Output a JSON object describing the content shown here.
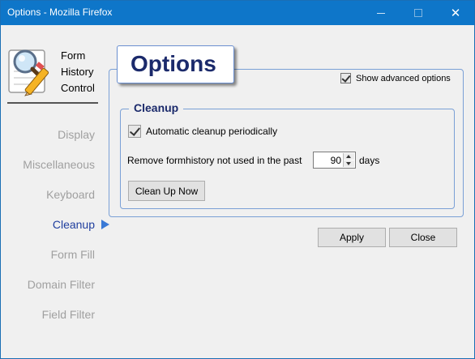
{
  "window": {
    "title": "Options - Mozilla Firefox",
    "controls": {
      "minimize": "minimize-icon",
      "maximize": "maximize-icon",
      "close": "close-icon"
    }
  },
  "brand": {
    "icon": "magnifier-pencil-icon",
    "lines": [
      "Form",
      "History",
      "Control"
    ]
  },
  "sidebar": {
    "items": [
      {
        "label": "Display"
      },
      {
        "label": "Miscellaneous"
      },
      {
        "label": "Keyboard"
      },
      {
        "label": "Cleanup"
      },
      {
        "label": "Form Fill"
      },
      {
        "label": "Domain Filter"
      },
      {
        "label": "Field Filter"
      }
    ],
    "active": "Cleanup",
    "active_color": "#1f3e9e",
    "inactive_color": "#a0a0a0"
  },
  "main": {
    "title": "Options",
    "show_advanced": {
      "label": "Show advanced options",
      "checked": true
    },
    "cleanup": {
      "legend": "Cleanup",
      "auto_cleanup": {
        "label": "Automatic cleanup periodically",
        "checked": true
      },
      "remove_label": "Remove formhistory not used in the past",
      "days_value": "90",
      "days_unit": "days",
      "cleanup_now": "Clean Up Now"
    }
  },
  "footer": {
    "apply": "Apply",
    "close": "Close"
  },
  "colors": {
    "titlebar": "#0e76c9",
    "heading": "#1b2a6b",
    "border_accent": "#7aa0d6"
  }
}
